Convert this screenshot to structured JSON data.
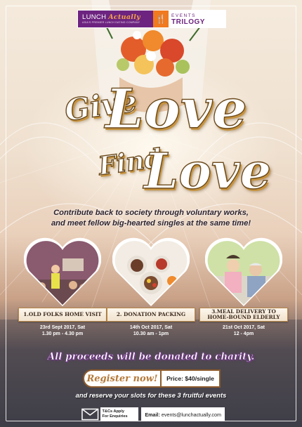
{
  "header": {
    "lunch_brand_plain": "LUNCH",
    "lunch_brand_accent": "Actually",
    "lunch_tagline": "ASIA'S PREMIER LUNCH DATING COMPANY",
    "events_small": "EVENTS",
    "events_big": "TRILOGY"
  },
  "headline": {
    "line1_small": "Give",
    "line1_big": "Love",
    "line2_small": "Find",
    "line2_big": "Love"
  },
  "subtitle": {
    "line1": "Contribute back to society through voluntary works,",
    "line2": "and meet fellow big-hearted singles at the same time!"
  },
  "activities": [
    {
      "title": "1.OLD FOLKS HOME VISIT",
      "date": "23rd Sept 2017, Sat",
      "time": "1.30 pm - 4.30 pm",
      "photo_icon": "classroom-photo"
    },
    {
      "title": "2. DONATION PACKING",
      "date": "14th Oct 2017, Sat",
      "time": "10.30 am - 1pm",
      "photo_icon": "food-packing-photo"
    },
    {
      "title_line1": "3.MEAL DELIVERY TO",
      "title_line2": "HOME-BOUND ELDERLY",
      "date": "21st Oct 2017, Sat",
      "time": "12 - 4pm",
      "photo_icon": "elderly-care-photo"
    }
  ],
  "charity_line": "All proceeds will be donated to charity.",
  "register": {
    "button_label": "Register now!",
    "price_label": "Price: $40/single"
  },
  "reserve_line": "and reserve your slots for these 3 fruitful events",
  "footer": {
    "tc_line1": "T&Cs Apply",
    "tc_line2": "For Enquiries",
    "email_label": "Email:",
    "email_value": "events@lunchactually.com"
  },
  "colors": {
    "brand_purple": "#6d2480",
    "brand_orange": "#f07a1f",
    "gold": "#c7933e",
    "frame": "#ffffff"
  }
}
